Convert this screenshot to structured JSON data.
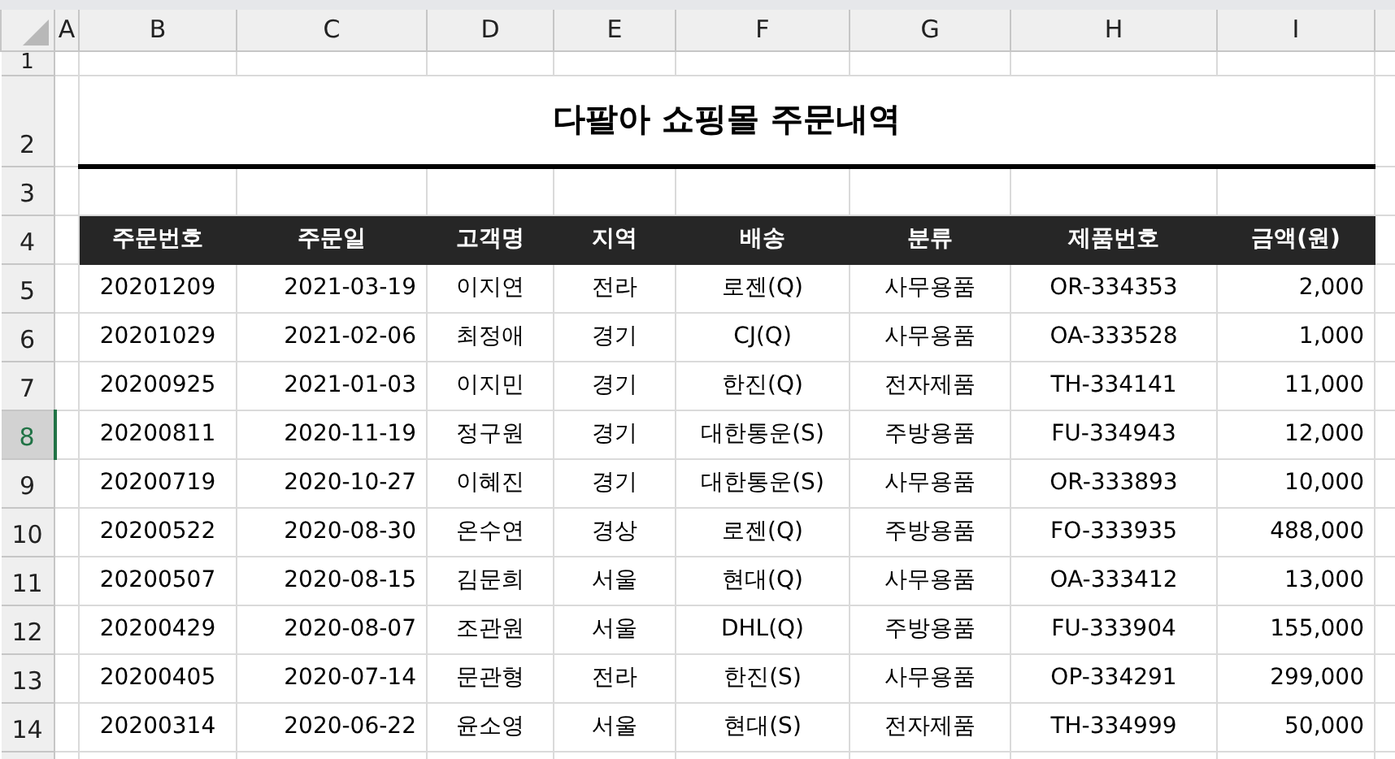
{
  "sheet": {
    "columns": [
      "A",
      "B",
      "C",
      "D",
      "E",
      "F",
      "G",
      "H",
      "I"
    ],
    "row_headers": [
      {
        "label": "1",
        "selected": false
      },
      {
        "label": "2",
        "selected": false
      },
      {
        "label": "3",
        "selected": false
      },
      {
        "label": "4",
        "selected": false
      },
      {
        "label": "5",
        "selected": false
      },
      {
        "label": "6",
        "selected": false
      },
      {
        "label": "7",
        "selected": false
      },
      {
        "label": "8",
        "selected": true
      },
      {
        "label": "9",
        "selected": false
      },
      {
        "label": "10",
        "selected": false
      },
      {
        "label": "11",
        "selected": false
      },
      {
        "label": "12",
        "selected": false
      },
      {
        "label": "13",
        "selected": false
      },
      {
        "label": "14",
        "selected": false
      }
    ],
    "title": "다팔아 쇼핑몰 주문내역",
    "table": {
      "columns": [
        "주문번호",
        "주문일",
        "고객명",
        "지역",
        "배송",
        "분류",
        "제품번호",
        "금액(원)"
      ],
      "rows": [
        [
          "20201209",
          "2021-03-19",
          "이지연",
          "전라",
          "로젠(Q)",
          "사무용품",
          "OR-334353",
          "2,000"
        ],
        [
          "20201029",
          "2021-02-06",
          "최정애",
          "경기",
          "CJ(Q)",
          "사무용품",
          "OA-333528",
          "1,000"
        ],
        [
          "20200925",
          "2021-01-03",
          "이지민",
          "경기",
          "한진(Q)",
          "전자제품",
          "TH-334141",
          "11,000"
        ],
        [
          "20200811",
          "2020-11-19",
          "정구원",
          "경기",
          "대한통운(S)",
          "주방용품",
          "FU-334943",
          "12,000"
        ],
        [
          "20200719",
          "2020-10-27",
          "이혜진",
          "경기",
          "대한통운(S)",
          "사무용품",
          "OR-333893",
          "10,000"
        ],
        [
          "20200522",
          "2020-08-30",
          "온수연",
          "경상",
          "로젠(Q)",
          "주방용품",
          "FO-333935",
          "488,000"
        ],
        [
          "20200507",
          "2020-08-15",
          "김문희",
          "서울",
          "현대(Q)",
          "사무용품",
          "OA-333412",
          "13,000"
        ],
        [
          "20200429",
          "2020-08-07",
          "조관원",
          "서울",
          "DHL(Q)",
          "주방용품",
          "FU-333904",
          "155,000"
        ],
        [
          "20200405",
          "2020-07-14",
          "문관형",
          "전라",
          "한진(S)",
          "사무용품",
          "OP-334291",
          "299,000"
        ],
        [
          "20200314",
          "2020-06-22",
          "윤소영",
          "서울",
          "현대(S)",
          "전자제품",
          "TH-334999",
          "50,000"
        ]
      ]
    }
  }
}
